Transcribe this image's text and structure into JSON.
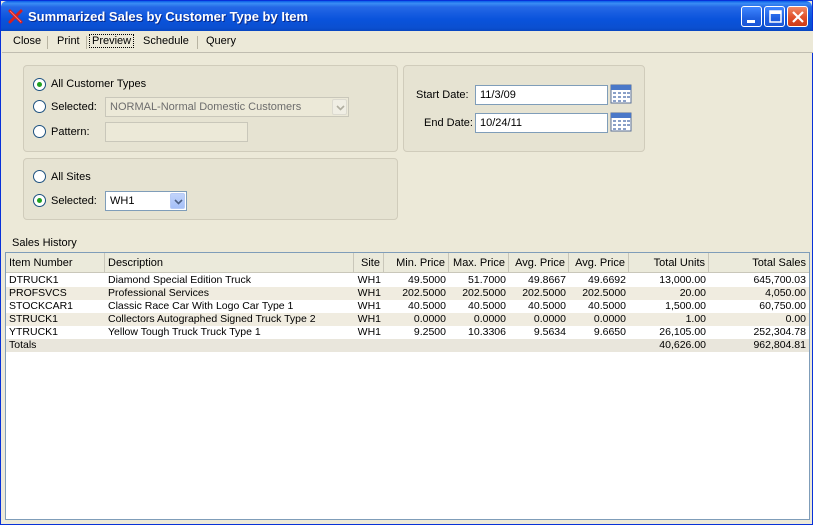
{
  "window": {
    "title": "Summarized Sales by Customer Type by Item",
    "icon": "x-app-icon"
  },
  "menu": {
    "items": [
      {
        "label": "Close"
      },
      {
        "label": "Print"
      },
      {
        "label": "Preview",
        "selected": true
      },
      {
        "label": "Schedule"
      },
      {
        "label": "Query"
      }
    ]
  },
  "customer_types": {
    "all_label": "All Customer Types",
    "all_checked": true,
    "selected_label": "Selected:",
    "selected_value": "NORMAL-Normal Domestic Customers",
    "pattern_label": "Pattern:",
    "pattern_value": ""
  },
  "sites": {
    "all_label": "All Sites",
    "selected_label": "Selected:",
    "selected_checked": true,
    "selected_value": "WH1"
  },
  "dates": {
    "start_label": "Start Date:",
    "start_value": "11/3/09",
    "end_label": "End Date:",
    "end_value": "10/24/11"
  },
  "sales_history": {
    "label": "Sales History",
    "columns": [
      "Item Number",
      "Description",
      "Site",
      "Min. Price",
      "Max. Price",
      "Avg. Price",
      "Avg. Price",
      "Total Units",
      "Total Sales"
    ],
    "rows": [
      [
        "DTRUCK1",
        "Diamond Special Edition Truck",
        "WH1",
        "49.5000",
        "51.7000",
        "49.8667",
        "49.6692",
        "13,000.00",
        "645,700.03"
      ],
      [
        "PROFSVCS",
        "Professional Services",
        "WH1",
        "202.5000",
        "202.5000",
        "202.5000",
        "202.5000",
        "20.00",
        "4,050.00"
      ],
      [
        "STOCKCAR1",
        "Classic Race Car With Logo Car Type 1",
        "WH1",
        "40.5000",
        "40.5000",
        "40.5000",
        "40.5000",
        "1,500.00",
        "60,750.00"
      ],
      [
        "STRUCK1",
        "Collectors Autographed Signed Truck Type 2",
        "WH1",
        "0.0000",
        "0.0000",
        "0.0000",
        "0.0000",
        "1.00",
        "0.00"
      ],
      [
        "YTRUCK1",
        "Yellow Tough Truck Truck Type 1",
        "WH1",
        "9.2500",
        "10.3306",
        "9.5634",
        "9.6650",
        "26,105.00",
        "252,304.78"
      ]
    ],
    "totals": [
      "Totals",
      "",
      "",
      "",
      "",
      "",
      "",
      "40,626.00",
      "962,804.81"
    ]
  },
  "colors": {
    "title_bar": "#0a53dc",
    "radio_dot": "#21a121",
    "window_bg": "#ece9d8"
  }
}
